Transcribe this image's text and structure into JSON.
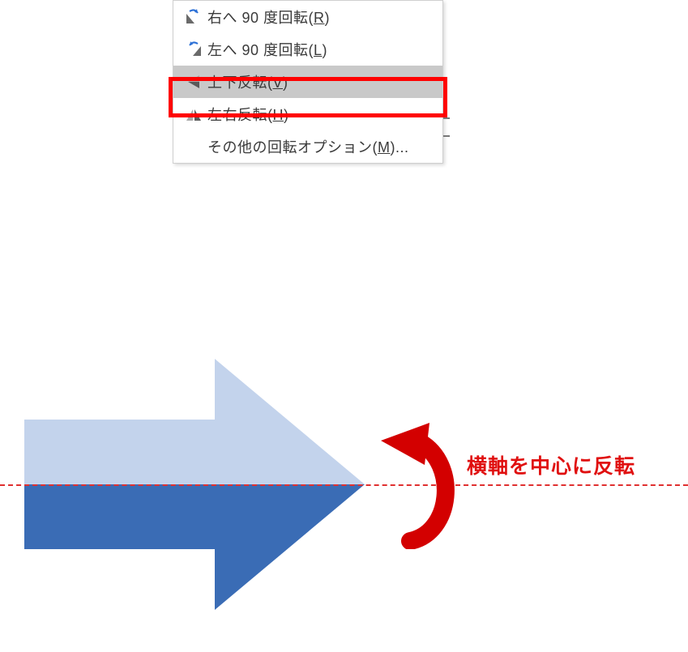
{
  "menu": {
    "items": [
      {
        "label_pre": "右へ 90 度回転(",
        "hotkey": "R",
        "label_post": ")",
        "icon": "rotate-right-icon"
      },
      {
        "label_pre": "左へ 90 度回転(",
        "hotkey": "L",
        "label_post": ")",
        "icon": "rotate-left-icon"
      },
      {
        "label_pre": "上下反転(",
        "hotkey": "V",
        "label_post": ")",
        "icon": "flip-vertical-icon",
        "highlighted": true
      },
      {
        "label_pre": "左右反転(",
        "hotkey": "H",
        "label_post": ")",
        "icon": "flip-horizontal-icon"
      },
      {
        "label_pre": "その他の回転オプション(",
        "hotkey": "M",
        "label_post": ")...",
        "icon": ""
      }
    ]
  },
  "annotation": {
    "caption": "横軸を中心に反転"
  },
  "colors": {
    "arrow_top_fill": "#c3d3ec",
    "arrow_bottom_fill": "#3a6cb5",
    "accent_red": "#e01010",
    "menu_highlight": "#c9c9c9"
  }
}
